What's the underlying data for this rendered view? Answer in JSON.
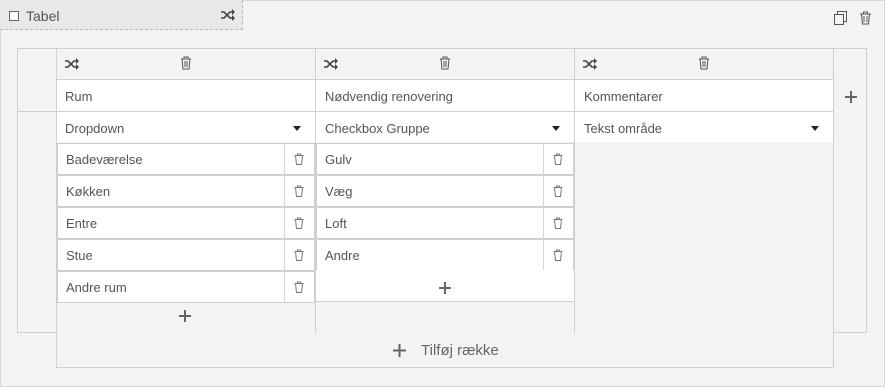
{
  "widget": {
    "title": "Tabel"
  },
  "columns": [
    {
      "header": "Rum",
      "type": "Dropdown",
      "options": [
        "Badeværelse",
        "Køkken",
        "Entre",
        "Stue",
        "Andre rum"
      ]
    },
    {
      "header": "Nødvendig renovering",
      "type": "Checkbox Gruppe",
      "options": [
        "Gulv",
        "Væg",
        "Loft",
        "Andre"
      ]
    },
    {
      "header": "Kommentarer",
      "type": "Tekst område",
      "options": []
    }
  ],
  "add_row_label": "Tilføj række",
  "icons": {
    "shuffle": "shuffle-icon",
    "trash": "trash-icon",
    "copy": "copy-icon",
    "plus": "plus-icon",
    "checkbox": "checkbox-icon",
    "caret": "caret-down-icon"
  }
}
